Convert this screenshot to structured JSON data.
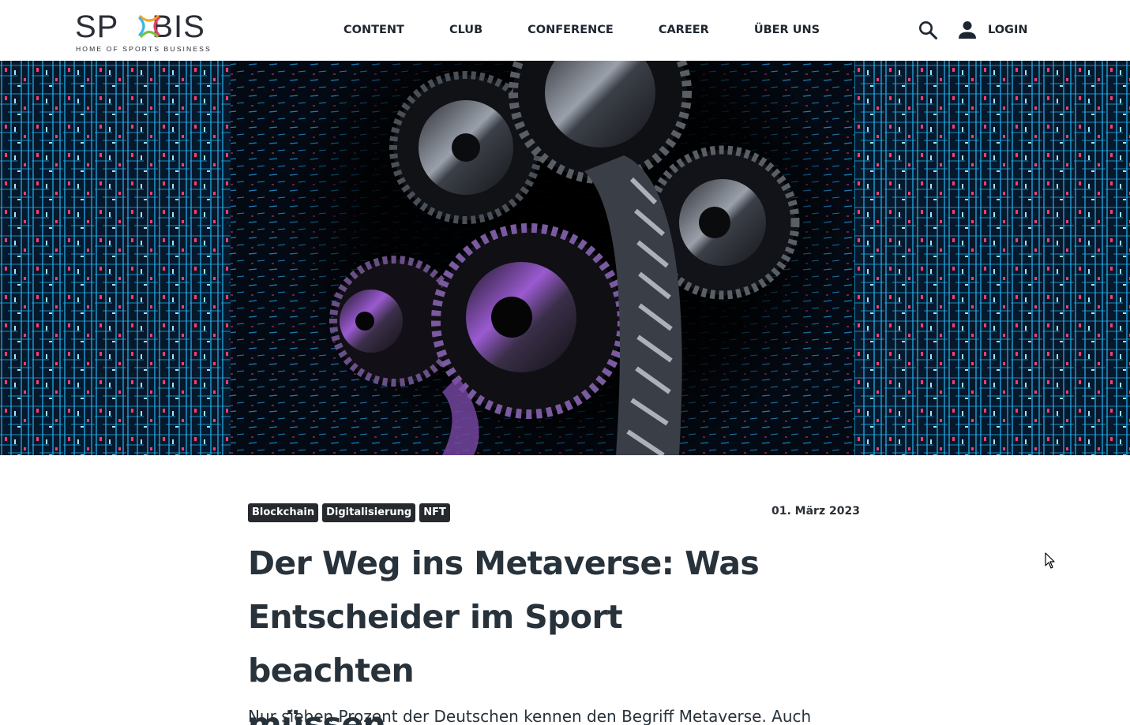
{
  "brand": {
    "name_left": "SP",
    "name_right": "BIS",
    "tagline": "HOME OF SPORTS BUSINESS",
    "colors": [
      "#3ab7e6",
      "#e6416e",
      "#f5a623",
      "#7cc242"
    ]
  },
  "nav": {
    "items": [
      {
        "label": "CONTENT"
      },
      {
        "label": "CLUB"
      },
      {
        "label": "CONFERENCE"
      },
      {
        "label": "CAREER"
      },
      {
        "label": "ÜBER UNS"
      }
    ],
    "search_icon": "search-icon",
    "login_icon": "user-icon",
    "login_label": "LOGIN"
  },
  "hero": {
    "image": "gears-and-digital-circuit-walls",
    "colors": {
      "circuit": "#23b4f0",
      "accent": "#ff3c6e",
      "gear": "#5a5f66"
    }
  },
  "article": {
    "tags": [
      "Blockchain",
      "Digitalisierung",
      "NFT"
    ],
    "date": "01. März 2023",
    "headline_lines": [
      "Der Weg ins Metaverse: Was",
      "Entscheider im Sport beachten",
      "müssen"
    ],
    "lead": "Nur sieben Prozent der Deutschen kennen den Begriff Metaverse. Auch"
  }
}
